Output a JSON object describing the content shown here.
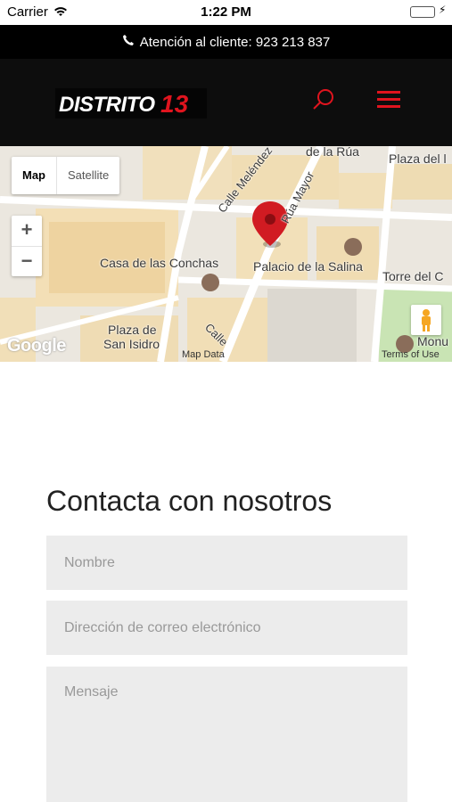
{
  "status_bar": {
    "carrier": "Carrier",
    "time": "1:22 PM"
  },
  "info_bar": {
    "text": "Atención al cliente: 923 213 837",
    "icon": "phone-icon"
  },
  "header": {
    "logo_text": "DISTRITO",
    "logo_number": "13",
    "search_icon": "search-icon",
    "menu_icon": "hamburger-menu-icon",
    "accent_color": "#e0141e",
    "background": "#0d0d0d"
  },
  "map": {
    "type_map": "Map",
    "type_satellite": "Satellite",
    "zoom_in": "+",
    "zoom_out": "−",
    "labels": {
      "calle_melendez": "Calle Meléndez",
      "de_la_rua": "de la Rúa",
      "plaza_del": "Plaza del l",
      "rua_mayor": "Rúa Mayor",
      "casa_conchas": "Casa de las Conchas",
      "palacio_salina": "Palacio de la Salina",
      "torre_del": "Torre del C",
      "plaza_de": "Plaza de",
      "san_isidro": "San Isidro",
      "calle": "Calle",
      "monu": "Monu"
    },
    "google": "Google",
    "map_data": "Map Data",
    "terms": "Terms of Use"
  },
  "contact": {
    "title": "Contacta con nosotros",
    "name_placeholder": "Nombre",
    "email_placeholder": "Dirección de correo electrónico",
    "message_placeholder": "Mensaje"
  }
}
